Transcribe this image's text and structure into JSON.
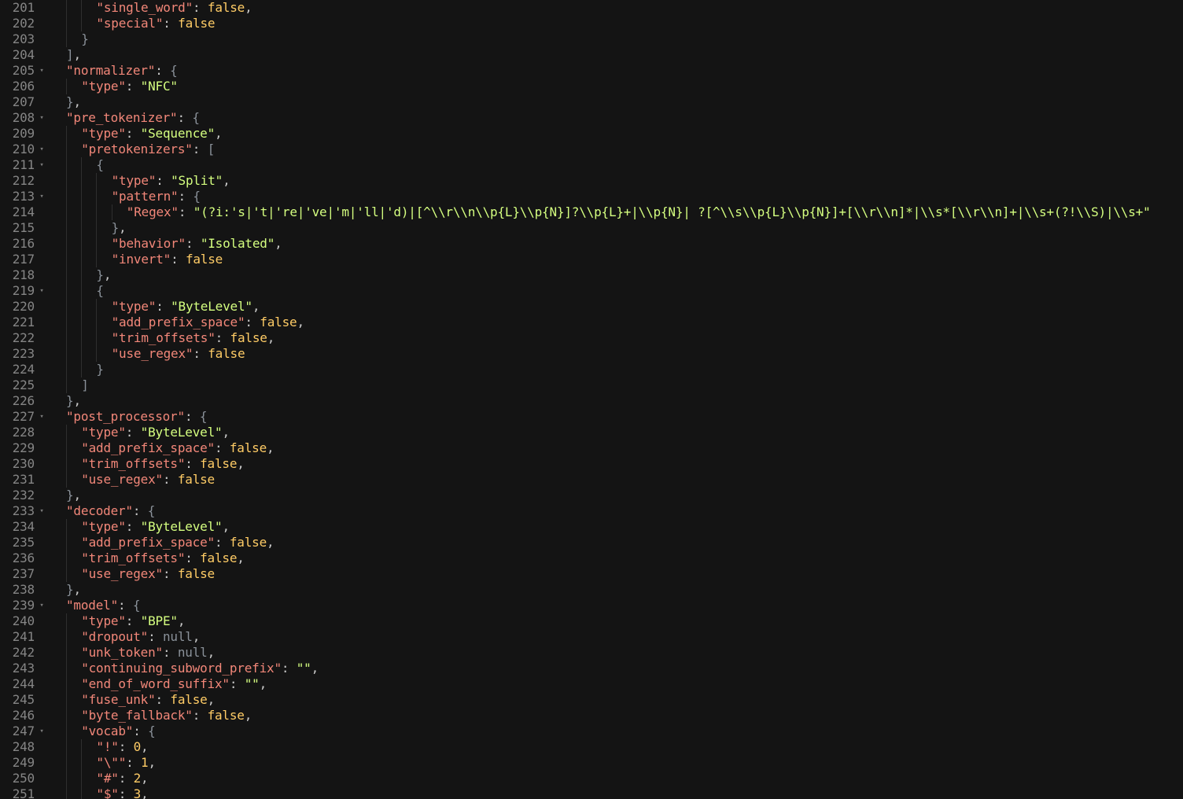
{
  "theme": {
    "background": "#141414",
    "line_number": "#858585",
    "key": "#f28779",
    "string": "#d5ff80",
    "punctuation": "#c9c9c9",
    "bracket": "#8a9199",
    "boolean_number": "#ffcc66",
    "null": "#8a9199",
    "fold_icon": "chevron-down-icon"
  },
  "lines": [
    {
      "n": "201",
      "indent": 2,
      "fold": false,
      "tokens": [
        [
          "k",
          "\"single_word\""
        ],
        [
          "p",
          ": "
        ],
        [
          "b",
          "false"
        ],
        [
          "p",
          ","
        ]
      ]
    },
    {
      "n": "202",
      "indent": 2,
      "fold": false,
      "tokens": [
        [
          "k",
          "\"special\""
        ],
        [
          "p",
          ": "
        ],
        [
          "b",
          "false"
        ]
      ]
    },
    {
      "n": "203",
      "indent": 1,
      "fold": false,
      "tokens": [
        [
          "br",
          "}"
        ]
      ]
    },
    {
      "n": "204",
      "indent": 0,
      "fold": false,
      "tokens": [
        [
          "br",
          "]"
        ],
        [
          "p",
          ","
        ]
      ]
    },
    {
      "n": "205",
      "indent": 0,
      "fold": true,
      "tokens": [
        [
          "k",
          "\"normalizer\""
        ],
        [
          "p",
          ": "
        ],
        [
          "br",
          "{"
        ]
      ]
    },
    {
      "n": "206",
      "indent": 1,
      "fold": false,
      "tokens": [
        [
          "k",
          "\"type\""
        ],
        [
          "p",
          ": "
        ],
        [
          "s",
          "\"NFC\""
        ]
      ]
    },
    {
      "n": "207",
      "indent": 0,
      "fold": false,
      "tokens": [
        [
          "br",
          "}"
        ],
        [
          "p",
          ","
        ]
      ]
    },
    {
      "n": "208",
      "indent": 0,
      "fold": true,
      "tokens": [
        [
          "k",
          "\"pre_tokenizer\""
        ],
        [
          "p",
          ": "
        ],
        [
          "br",
          "{"
        ]
      ]
    },
    {
      "n": "209",
      "indent": 1,
      "fold": false,
      "tokens": [
        [
          "k",
          "\"type\""
        ],
        [
          "p",
          ": "
        ],
        [
          "s",
          "\"Sequence\""
        ],
        [
          "p",
          ","
        ]
      ]
    },
    {
      "n": "210",
      "indent": 1,
      "fold": true,
      "tokens": [
        [
          "k",
          "\"pretokenizers\""
        ],
        [
          "p",
          ": "
        ],
        [
          "br",
          "["
        ]
      ]
    },
    {
      "n": "211",
      "indent": 2,
      "fold": true,
      "tokens": [
        [
          "br",
          "{"
        ]
      ]
    },
    {
      "n": "212",
      "indent": 3,
      "fold": false,
      "tokens": [
        [
          "k",
          "\"type\""
        ],
        [
          "p",
          ": "
        ],
        [
          "s",
          "\"Split\""
        ],
        [
          "p",
          ","
        ]
      ]
    },
    {
      "n": "213",
      "indent": 3,
      "fold": true,
      "tokens": [
        [
          "k",
          "\"pattern\""
        ],
        [
          "p",
          ": "
        ],
        [
          "br",
          "{"
        ]
      ]
    },
    {
      "n": "214",
      "indent": 4,
      "fold": false,
      "tokens": [
        [
          "k",
          "\"Regex\""
        ],
        [
          "p",
          ": "
        ],
        [
          "s",
          "\"(?i:'s|'t|'re|'ve|'m|'ll|'d)|[^\\\\r\\\\n\\\\p{L}\\\\p{N}]?\\\\p{L}+|\\\\p{N}| ?[^\\\\s\\\\p{L}\\\\p{N}]+[\\\\r\\\\n]*|\\\\s*[\\\\r\\\\n]+|\\\\s+(?!\\\\S)|\\\\s+\""
        ]
      ]
    },
    {
      "n": "215",
      "indent": 3,
      "fold": false,
      "tokens": [
        [
          "br",
          "}"
        ],
        [
          "p",
          ","
        ]
      ]
    },
    {
      "n": "216",
      "indent": 3,
      "fold": false,
      "tokens": [
        [
          "k",
          "\"behavior\""
        ],
        [
          "p",
          ": "
        ],
        [
          "s",
          "\"Isolated\""
        ],
        [
          "p",
          ","
        ]
      ]
    },
    {
      "n": "217",
      "indent": 3,
      "fold": false,
      "tokens": [
        [
          "k",
          "\"invert\""
        ],
        [
          "p",
          ": "
        ],
        [
          "b",
          "false"
        ]
      ]
    },
    {
      "n": "218",
      "indent": 2,
      "fold": false,
      "tokens": [
        [
          "br",
          "}"
        ],
        [
          "p",
          ","
        ]
      ]
    },
    {
      "n": "219",
      "indent": 2,
      "fold": true,
      "tokens": [
        [
          "br",
          "{"
        ]
      ]
    },
    {
      "n": "220",
      "indent": 3,
      "fold": false,
      "tokens": [
        [
          "k",
          "\"type\""
        ],
        [
          "p",
          ": "
        ],
        [
          "s",
          "\"ByteLevel\""
        ],
        [
          "p",
          ","
        ]
      ]
    },
    {
      "n": "221",
      "indent": 3,
      "fold": false,
      "tokens": [
        [
          "k",
          "\"add_prefix_space\""
        ],
        [
          "p",
          ": "
        ],
        [
          "b",
          "false"
        ],
        [
          "p",
          ","
        ]
      ]
    },
    {
      "n": "222",
      "indent": 3,
      "fold": false,
      "tokens": [
        [
          "k",
          "\"trim_offsets\""
        ],
        [
          "p",
          ": "
        ],
        [
          "b",
          "false"
        ],
        [
          "p",
          ","
        ]
      ]
    },
    {
      "n": "223",
      "indent": 3,
      "fold": false,
      "tokens": [
        [
          "k",
          "\"use_regex\""
        ],
        [
          "p",
          ": "
        ],
        [
          "b",
          "false"
        ]
      ]
    },
    {
      "n": "224",
      "indent": 2,
      "fold": false,
      "tokens": [
        [
          "br",
          "}"
        ]
      ]
    },
    {
      "n": "225",
      "indent": 1,
      "fold": false,
      "tokens": [
        [
          "br",
          "]"
        ]
      ]
    },
    {
      "n": "226",
      "indent": 0,
      "fold": false,
      "tokens": [
        [
          "br",
          "}"
        ],
        [
          "p",
          ","
        ]
      ]
    },
    {
      "n": "227",
      "indent": 0,
      "fold": true,
      "tokens": [
        [
          "k",
          "\"post_processor\""
        ],
        [
          "p",
          ": "
        ],
        [
          "br",
          "{"
        ]
      ]
    },
    {
      "n": "228",
      "indent": 1,
      "fold": false,
      "tokens": [
        [
          "k",
          "\"type\""
        ],
        [
          "p",
          ": "
        ],
        [
          "s",
          "\"ByteLevel\""
        ],
        [
          "p",
          ","
        ]
      ]
    },
    {
      "n": "229",
      "indent": 1,
      "fold": false,
      "tokens": [
        [
          "k",
          "\"add_prefix_space\""
        ],
        [
          "p",
          ": "
        ],
        [
          "b",
          "false"
        ],
        [
          "p",
          ","
        ]
      ]
    },
    {
      "n": "230",
      "indent": 1,
      "fold": false,
      "tokens": [
        [
          "k",
          "\"trim_offsets\""
        ],
        [
          "p",
          ": "
        ],
        [
          "b",
          "false"
        ],
        [
          "p",
          ","
        ]
      ]
    },
    {
      "n": "231",
      "indent": 1,
      "fold": false,
      "tokens": [
        [
          "k",
          "\"use_regex\""
        ],
        [
          "p",
          ": "
        ],
        [
          "b",
          "false"
        ]
      ]
    },
    {
      "n": "232",
      "indent": 0,
      "fold": false,
      "tokens": [
        [
          "br",
          "}"
        ],
        [
          "p",
          ","
        ]
      ]
    },
    {
      "n": "233",
      "indent": 0,
      "fold": true,
      "tokens": [
        [
          "k",
          "\"decoder\""
        ],
        [
          "p",
          ": "
        ],
        [
          "br",
          "{"
        ]
      ]
    },
    {
      "n": "234",
      "indent": 1,
      "fold": false,
      "tokens": [
        [
          "k",
          "\"type\""
        ],
        [
          "p",
          ": "
        ],
        [
          "s",
          "\"ByteLevel\""
        ],
        [
          "p",
          ","
        ]
      ]
    },
    {
      "n": "235",
      "indent": 1,
      "fold": false,
      "tokens": [
        [
          "k",
          "\"add_prefix_space\""
        ],
        [
          "p",
          ": "
        ],
        [
          "b",
          "false"
        ],
        [
          "p",
          ","
        ]
      ]
    },
    {
      "n": "236",
      "indent": 1,
      "fold": false,
      "tokens": [
        [
          "k",
          "\"trim_offsets\""
        ],
        [
          "p",
          ": "
        ],
        [
          "b",
          "false"
        ],
        [
          "p",
          ","
        ]
      ]
    },
    {
      "n": "237",
      "indent": 1,
      "fold": false,
      "tokens": [
        [
          "k",
          "\"use_regex\""
        ],
        [
          "p",
          ": "
        ],
        [
          "b",
          "false"
        ]
      ]
    },
    {
      "n": "238",
      "indent": 0,
      "fold": false,
      "tokens": [
        [
          "br",
          "}"
        ],
        [
          "p",
          ","
        ]
      ]
    },
    {
      "n": "239",
      "indent": 0,
      "fold": true,
      "tokens": [
        [
          "k",
          "\"model\""
        ],
        [
          "p",
          ": "
        ],
        [
          "br",
          "{"
        ]
      ]
    },
    {
      "n": "240",
      "indent": 1,
      "fold": false,
      "tokens": [
        [
          "k",
          "\"type\""
        ],
        [
          "p",
          ": "
        ],
        [
          "s",
          "\"BPE\""
        ],
        [
          "p",
          ","
        ]
      ]
    },
    {
      "n": "241",
      "indent": 1,
      "fold": false,
      "tokens": [
        [
          "k",
          "\"dropout\""
        ],
        [
          "p",
          ": "
        ],
        [
          "nl",
          "null"
        ],
        [
          "p",
          ","
        ]
      ]
    },
    {
      "n": "242",
      "indent": 1,
      "fold": false,
      "tokens": [
        [
          "k",
          "\"unk_token\""
        ],
        [
          "p",
          ": "
        ],
        [
          "nl",
          "null"
        ],
        [
          "p",
          ","
        ]
      ]
    },
    {
      "n": "243",
      "indent": 1,
      "fold": false,
      "tokens": [
        [
          "k",
          "\"continuing_subword_prefix\""
        ],
        [
          "p",
          ": "
        ],
        [
          "s",
          "\"\""
        ],
        [
          "p",
          ","
        ]
      ]
    },
    {
      "n": "244",
      "indent": 1,
      "fold": false,
      "tokens": [
        [
          "k",
          "\"end_of_word_suffix\""
        ],
        [
          "p",
          ": "
        ],
        [
          "s",
          "\"\""
        ],
        [
          "p",
          ","
        ]
      ]
    },
    {
      "n": "245",
      "indent": 1,
      "fold": false,
      "tokens": [
        [
          "k",
          "\"fuse_unk\""
        ],
        [
          "p",
          ": "
        ],
        [
          "b",
          "false"
        ],
        [
          "p",
          ","
        ]
      ]
    },
    {
      "n": "246",
      "indent": 1,
      "fold": false,
      "tokens": [
        [
          "k",
          "\"byte_fallback\""
        ],
        [
          "p",
          ": "
        ],
        [
          "b",
          "false"
        ],
        [
          "p",
          ","
        ]
      ]
    },
    {
      "n": "247",
      "indent": 1,
      "fold": true,
      "tokens": [
        [
          "k",
          "\"vocab\""
        ],
        [
          "p",
          ": "
        ],
        [
          "br",
          "{"
        ]
      ]
    },
    {
      "n": "248",
      "indent": 2,
      "fold": false,
      "tokens": [
        [
          "k",
          "\"!\""
        ],
        [
          "p",
          ": "
        ],
        [
          "num",
          "0"
        ],
        [
          "p",
          ","
        ]
      ]
    },
    {
      "n": "249",
      "indent": 2,
      "fold": false,
      "tokens": [
        [
          "k",
          "\"\\\"\""
        ],
        [
          "p",
          ": "
        ],
        [
          "num",
          "1"
        ],
        [
          "p",
          ","
        ]
      ]
    },
    {
      "n": "250",
      "indent": 2,
      "fold": false,
      "tokens": [
        [
          "k",
          "\"#\""
        ],
        [
          "p",
          ": "
        ],
        [
          "num",
          "2"
        ],
        [
          "p",
          ","
        ]
      ]
    },
    {
      "n": "251",
      "indent": 2,
      "fold": false,
      "tokens": [
        [
          "k",
          "\"$\""
        ],
        [
          "p",
          ": "
        ],
        [
          "num",
          "3"
        ],
        [
          "p",
          ","
        ]
      ]
    }
  ]
}
